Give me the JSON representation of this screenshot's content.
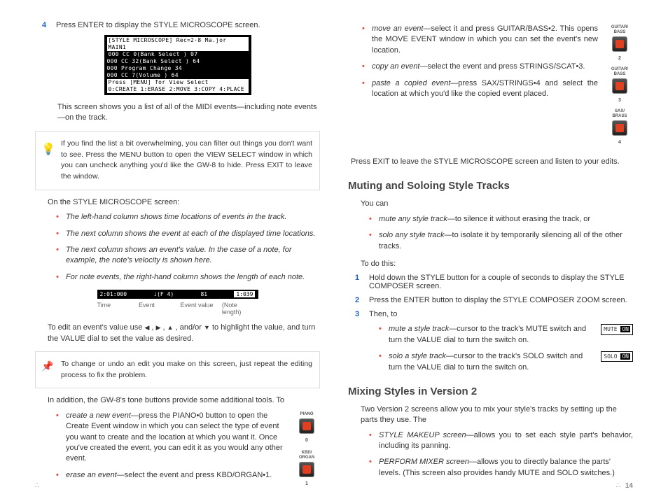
{
  "left": {
    "step4_num": "4",
    "step4_txt": "Press ENTER to display the STYLE MICROSCOPE screen.",
    "lcd1_title": "[STYLE MICROSCOPE]  Rec=2·8  Ma.jor  MAIN1",
    "lcd1_l1": "000    CC  0(Bank Select )  07",
    "lcd1_l2": "000    CC 32(Bank Select )  64",
    "lcd1_l3": "000    Program Change        34",
    "lcd1_l4": "000    CC  7(Volume      )  64",
    "lcd1_foot1": "Press [MENU] for View Select",
    "lcd1_foot2": "0:CREATE 1:ERASE 2:MOVE 3:COPY 4:PLACE",
    "after_lcd": "This screen shows you a list of all of the MIDI events—including note events—on the track.",
    "tip1": "If you find the list a bit overwhelming, you can filter out things you don't want to see. Press the MENU button to open the VIEW SELECT window in which you can uncheck anything you'd like the GW-8 to hide. Press EXIT to leave the window.",
    "on_screen": "On the STYLE MICROSCOPE screen:",
    "b1": "The left-hand column shows time locations of events in the track.",
    "b2": "The next column shows the event at each of the displayed time locations.",
    "b3": "The next column shows an event's value. In the case of a note, for example, the note's velocity is shown here.",
    "b4": "For note events, the right-hand column shows the length of each note.",
    "row_time": "2:01:000",
    "row_event": "♩(F 4)",
    "row_val": "81",
    "row_len": "1:039",
    "lbl_time": "Time",
    "lbl_event": "Event",
    "lbl_val": "Event value",
    "lbl_len": "(Note length)",
    "edit_p": "To edit an event's value use  ◀ ,  ▶ ,  ▲ , and/or  ▼  to highlight the value, and turn the VALUE dial to set the value as desired.",
    "tip2": "To change or undo an edit you make on this screen, just repeat the editing process to fix the problem.",
    "addl": "In addition, the GW-8's tone buttons provide some additional tools. To",
    "create_em": "create a new event",
    "create_txt": "—press the PIANO•0 button to open the Create Event window in which you can select the type of event you want to create and the location at which you want it. Once you've created the event, you can edit it as you would any other event.",
    "erase_em": "erase an event",
    "erase_txt": "—select the event and press KBD/ORGAN•1.",
    "pad_piano": "PIANO",
    "pad_piano_n": "0",
    "pad_kbd": "KBD/\nORGAN",
    "pad_kbd_n": "1"
  },
  "right": {
    "move_em": "move an event",
    "move_txt": "—select it and press GUITAR/BASS•2. This opens the MOVE EVENT window in which you can set the event's new location.",
    "copy_em": "copy an event",
    "copy_txt": "—select the event and press STRINGS/SCAT•3.",
    "paste_em": "paste a copied event",
    "paste_txt": "—press SAX/STRINGS•4 and select the location at which you'd like the copied event placed.",
    "exit_p": "Press EXIT to leave the STYLE MICROSCOPE screen and listen to your edits.",
    "h1": "Muting and Soloing Style Tracks",
    "youcan": "You can",
    "mute_em": "mute any style track",
    "mute_txt": "—to silence it without erasing the track, or",
    "solo_em": "solo any style track",
    "solo_txt": "—to isolate it by temporarily silencing all of the other tracks.",
    "todo": "To do this:",
    "s1_n": "1",
    "s1": "Hold down the STYLE button for a couple of seconds to display the STYLE COMPOSER screen.",
    "s2_n": "2",
    "s2": "Press the ENTER button to display the STYLE COMPOSER ZOOM screen.",
    "s3_n": "3",
    "s3": "Then, to",
    "mst_em": "mute a style track",
    "mst": "—cursor to the track's MUTE switch and turn the VALUE dial to turn the switch on.",
    "sst_em": "solo a style track",
    "sst": "—cursor to the track's SOLO switch and turn the VALUE dial to turn the switch on.",
    "sw_mute": "MUTE",
    "sw_solo": "SOLO",
    "sw_on": "ON",
    "h2": "Mixing Styles in Version 2",
    "mix_p": "Two Version 2 screens allow you to mix your style's tracks by setting up the parts they use. The",
    "smk_em": "STYLE MAKEUP screen",
    "smk": "—allows you to set each style part's behavior, including its panning.",
    "pmx_em": "PERFORM MIXER screen",
    "pmx": "—allows you to directly balance the parts' levels. (This screen also provides handy MUTE and SOLO switches.)",
    "pad_gb": "GUITAR/\nBASS",
    "pad_gb_n": "2",
    "pad_gb2": "GUITAR/\nBASS",
    "pad_gb2_n": "3",
    "pad_sax": "SAX/\nBRASS",
    "pad_sax_n": "4"
  },
  "page": "14"
}
